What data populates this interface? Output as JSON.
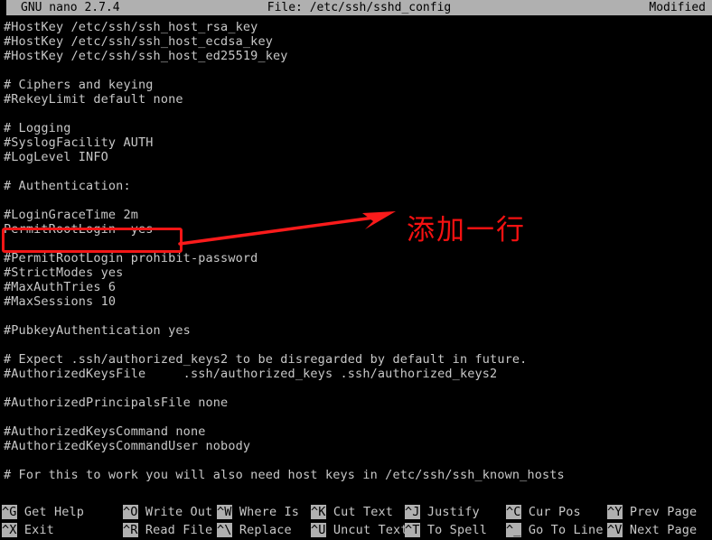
{
  "titlebar": {
    "app": "GNU nano 2.7.4",
    "file_label": "File: /etc/ssh/sshd_config",
    "status": "Modified"
  },
  "annotation": {
    "note_text": "添加一行",
    "note_color": "#f41111",
    "box_color": "#f21616",
    "arrow_color": "#fa1b1b",
    "highlighted_line": "PermitRootLogin  yes"
  },
  "editor": {
    "lines": [
      "#HostKey /etc/ssh/ssh_host_rsa_key",
      "#HostKey /etc/ssh/ssh_host_ecdsa_key",
      "#HostKey /etc/ssh/ssh_host_ed25519_key",
      "",
      "# Ciphers and keying",
      "#RekeyLimit default none",
      "",
      "# Logging",
      "#SyslogFacility AUTH",
      "#LogLevel INFO",
      "",
      "# Authentication:",
      "",
      "#LoginGraceTime 2m",
      "PermitRootLogin  yes",
      "",
      "#PermitRootLogin prohibit-password",
      "#StrictModes yes",
      "#MaxAuthTries 6",
      "#MaxSessions 10",
      "",
      "#PubkeyAuthentication yes",
      "",
      "# Expect .ssh/authorized_keys2 to be disregarded by default in future.",
      "#AuthorizedKeysFile     .ssh/authorized_keys .ssh/authorized_keys2",
      "",
      "#AuthorizedPrincipalsFile none",
      "",
      "#AuthorizedKeysCommand none",
      "#AuthorizedKeysCommandUser nobody",
      "",
      "# For this to work you will also need host keys in /etc/ssh/ssh_known_hosts"
    ]
  },
  "helpbar": {
    "row1": [
      {
        "key": "^G",
        "label": " Get Help"
      },
      {
        "key": "^O",
        "label": " Write Out"
      },
      {
        "key": "^W",
        "label": " Where Is"
      },
      {
        "key": "^K",
        "label": " Cut Text"
      },
      {
        "key": "^J",
        "label": " Justify"
      },
      {
        "key": "^C",
        "label": " Cur Pos"
      },
      {
        "key": "^Y",
        "label": " Prev Page"
      }
    ],
    "row2": [
      {
        "key": "^X",
        "label": " Exit"
      },
      {
        "key": "^R",
        "label": " Read File"
      },
      {
        "key": "^\\",
        "label": " Replace"
      },
      {
        "key": "^U",
        "label": " Uncut Text"
      },
      {
        "key": "^T",
        "label": " To Spell"
      },
      {
        "key": "^_",
        "label": " Go To Line"
      },
      {
        "key": "^V",
        "label": " Next Page"
      }
    ]
  }
}
